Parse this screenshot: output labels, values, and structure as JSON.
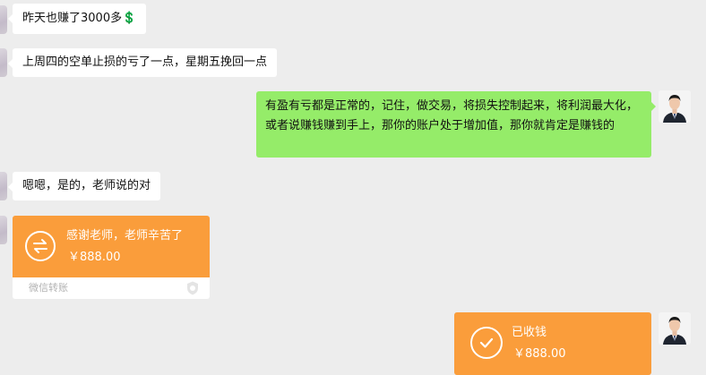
{
  "messages": {
    "m1": "昨天也赚了3000多💲",
    "m2": "上周四的空单止损的亏了一点，星期五挽回一点",
    "m3": "有盈有亏都是正常的，记住，做交易，将损失控制起来，将利润最大化，或者说赚钱赚到手上，那你的账户处于增加值，那你就肯定是赚钱的",
    "m4": "嗯嗯，是的，老师说的对"
  },
  "transfer_sent": {
    "title": "感谢老师，老师辛苦了",
    "amount": "￥888.00",
    "footer": "微信转账"
  },
  "transfer_received": {
    "title": "已收钱",
    "amount": "￥888.00"
  },
  "colors": {
    "background": "#ededed",
    "self_bubble": "#95ec69",
    "transfer": "#fa9d3b"
  }
}
